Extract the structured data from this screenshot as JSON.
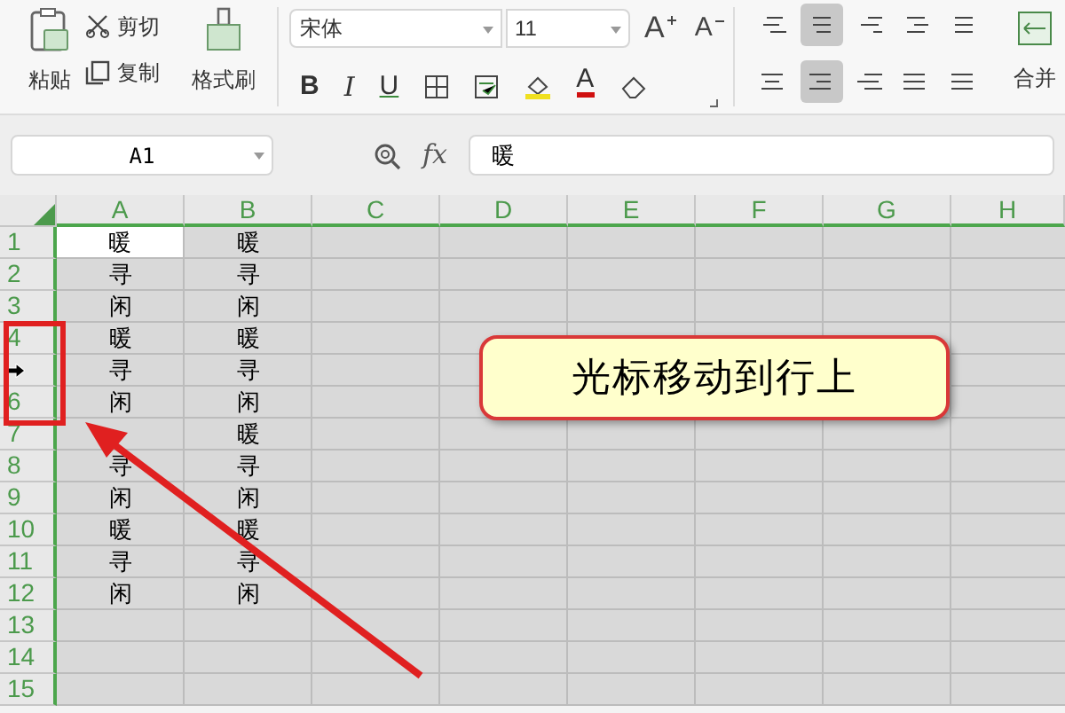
{
  "toolbar": {
    "paste": "粘贴",
    "cut": "剪切",
    "copy": "复制",
    "format_painter": "格式刷",
    "font_name": "宋体",
    "font_size": "11",
    "grow_font": "A",
    "shrink_font": "A",
    "bold": "B",
    "italic": "I",
    "underline": "U",
    "font_color": "A",
    "merge": "合并"
  },
  "formula_bar": {
    "name_box": "A1",
    "fx": "fx",
    "value": "暖"
  },
  "columns": [
    "A",
    "B",
    "C",
    "D",
    "E",
    "F",
    "G",
    "H"
  ],
  "rows": [
    {
      "header": "1",
      "a": "暖",
      "b": "暖",
      "active": true
    },
    {
      "header": "2",
      "a": "寻",
      "b": "寻"
    },
    {
      "header": "3",
      "a": "闲",
      "b": "闲"
    },
    {
      "header": "4",
      "a": "暖",
      "b": "暖"
    },
    {
      "cursor": true,
      "a": "寻",
      "b": "寻"
    },
    {
      "header": "6",
      "a": "闲",
      "b": "闲"
    },
    {
      "header": "7",
      "b": "暖"
    },
    {
      "header": "8",
      "a": "寻",
      "b": "寻"
    },
    {
      "header": "9",
      "a": "闲",
      "b": "闲"
    },
    {
      "header": "10",
      "a": "暖",
      "b": "暖"
    },
    {
      "header": "11",
      "a": "寻",
      "b": "寻"
    },
    {
      "header": "12",
      "a": "闲",
      "b": "闲"
    },
    {
      "header": "13"
    },
    {
      "header": "14"
    },
    {
      "header": "15"
    }
  ],
  "callout": "光标移动到行上"
}
